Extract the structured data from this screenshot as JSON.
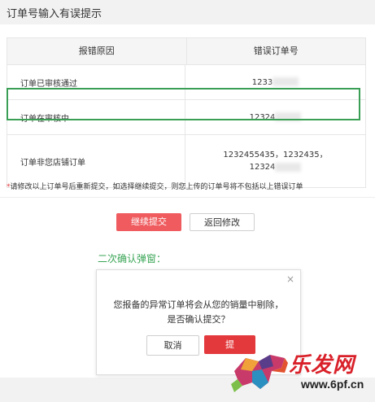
{
  "header": {
    "title": "订单号输入有误提示"
  },
  "table": {
    "headers": [
      "报错原因",
      "错误订单号"
    ],
    "rows": [
      {
        "reason": "订单已审核通过",
        "orders": [
          "1233"
        ]
      },
      {
        "reason": "订单在审核中",
        "orders": [
          "12324"
        ]
      },
      {
        "reason": "订单非您店铺订单",
        "orders": [
          "1232455435，1232435，",
          "12324"
        ]
      }
    ]
  },
  "note": {
    "star": "*",
    "text": "请修改以上订单号后重新提交，如选择继续提交，则您上传的订单号将不包括以上错误订单"
  },
  "actions": {
    "continue": "继续提交",
    "back": "返回修改"
  },
  "section_label": "二次确认弹窗：",
  "dialog": {
    "close": "×",
    "line1": "您报备的异常订单将会从您的销量中剔除，",
    "line2": "是否确认提交？",
    "cancel": "取消",
    "confirm": "提"
  },
  "watermark": {
    "text": "乐发网",
    "url": "www.6pf.cn"
  },
  "colors": {
    "accent_red": "#ef5b5e",
    "highlight_green": "#3a9f55",
    "label_green": "#3aa556"
  }
}
